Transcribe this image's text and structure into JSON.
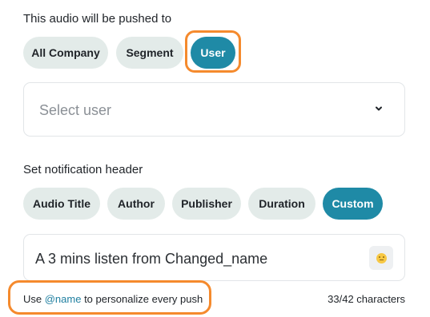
{
  "audience": {
    "heading": "This audio will be pushed to",
    "options": [
      "All Company",
      "Segment",
      "User"
    ],
    "selected": "User",
    "select_placeholder": "Select user"
  },
  "notification": {
    "heading": "Set notification header",
    "options": [
      "Audio Title",
      "Author",
      "Publisher",
      "Duration",
      "Custom"
    ],
    "selected": "Custom",
    "value": "A 3 mins listen from Changed_name",
    "hint_prefix": "Use ",
    "hint_mention": "@name",
    "hint_suffix": " to personalize every push",
    "counter": "33/42 characters"
  },
  "colors": {
    "accent": "#1f8aa6",
    "pill_bg": "#e3ebe9",
    "annotation": "#f58a2d"
  },
  "icons": {
    "select_chevron": "chevron-down-icon",
    "emoji": "emoji-smile-icon"
  }
}
